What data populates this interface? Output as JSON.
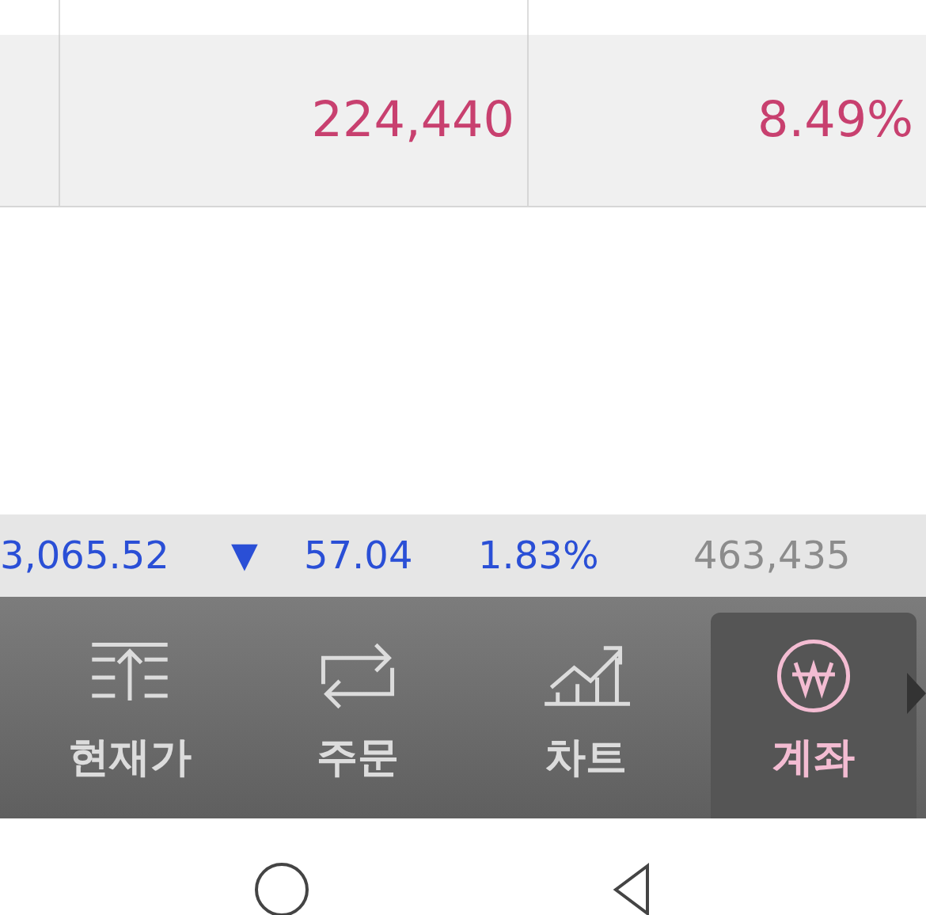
{
  "table": {
    "rows": [
      {
        "cells": [
          "",
          "224,440",
          "8.49%"
        ]
      }
    ]
  },
  "ticker": {
    "value": "3,065.52",
    "falling": true,
    "arrow": "▼",
    "change": "57.04",
    "percent": "1.83%",
    "volume": "463,435"
  },
  "tabs": [
    {
      "label": "현재가",
      "selected": false
    },
    {
      "label": "주문",
      "selected": false
    },
    {
      "label": "차트",
      "selected": false
    },
    {
      "label": "계좌",
      "selected": true
    }
  ]
}
